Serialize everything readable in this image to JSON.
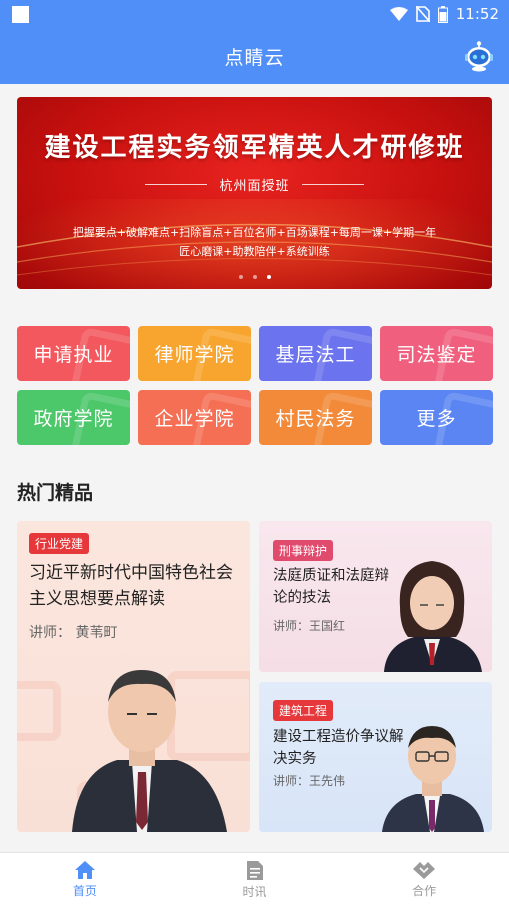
{
  "status_bar": {
    "time": "11:52"
  },
  "header": {
    "title": "点睛云",
    "robot_icon": "robot-icon"
  },
  "banner": {
    "title": "建设工程实务领军精英人才研修班",
    "subtitle": "杭州面授班",
    "desc_line1": "把握要点+破解难点+扫除盲点+百位名师+百场课程+每周一课+学期一年",
    "desc_line2": "匠心磨课+助教陪伴+系统训练",
    "slides": 3,
    "active_slide": 3
  },
  "categories": [
    {
      "label": "申请执业",
      "color": "#f2585e"
    },
    {
      "label": "律师学院",
      "color": "#f8a52f"
    },
    {
      "label": "基层法工",
      "color": "#6b73ee"
    },
    {
      "label": "司法鉴定",
      "color": "#f0607e"
    },
    {
      "label": "政府学院",
      "color": "#4cc76a"
    },
    {
      "label": "企业学院",
      "color": "#f56f54"
    },
    {
      "label": "村民法务",
      "color": "#f28a3a"
    },
    {
      "label": "更多",
      "color": "#5a85f2"
    }
  ],
  "section": {
    "title": "热门精品"
  },
  "cards": [
    {
      "tag": "行业党建",
      "title": "习近平新时代中国特色社会主义思想要点解读",
      "teacher": "讲师：  黄苇町"
    },
    {
      "tag": "刑事辩护",
      "title": "法庭质证和法庭辩论的技法",
      "teacher": "讲师：王国红"
    },
    {
      "tag": "建筑工程",
      "title": "建设工程造价争议解决实务",
      "teacher": "讲师：王先伟"
    }
  ],
  "tabbar": {
    "items": [
      {
        "label": "首页",
        "icon": "home-icon"
      },
      {
        "label": "时讯",
        "icon": "news-icon"
      },
      {
        "label": "合作",
        "icon": "handshake-icon"
      }
    ],
    "active_color": "#4f8ff7",
    "inactive_color": "#9a9a9a"
  }
}
